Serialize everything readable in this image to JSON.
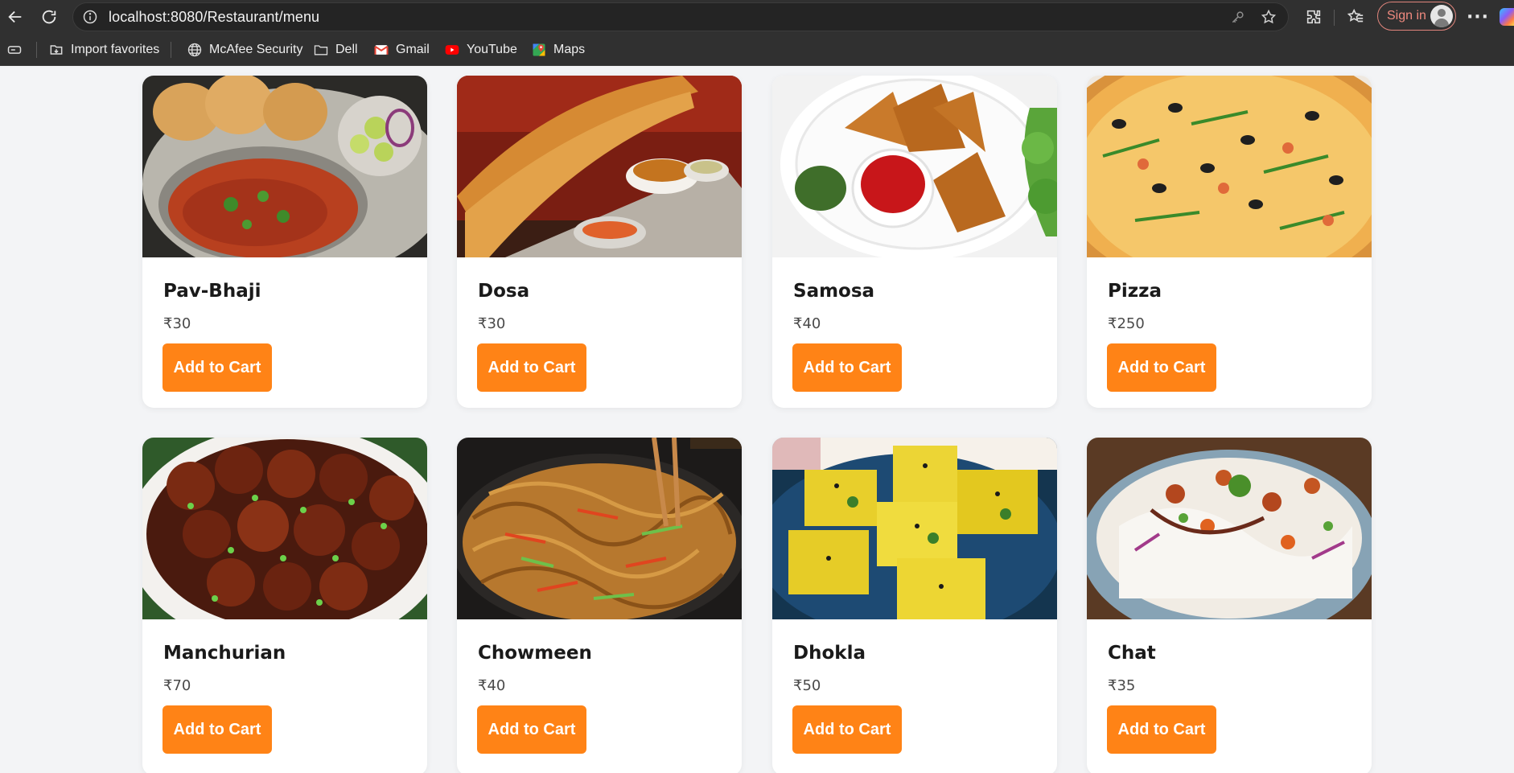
{
  "browser": {
    "url": "localhost:8080/Restaurant/menu",
    "sign_in_label": "Sign in",
    "bookmarks": [
      {
        "label": "Import favorites",
        "icon": "import-icon"
      },
      {
        "label": "McAfee Security",
        "icon": "globe-icon"
      },
      {
        "label": "Dell",
        "icon": "folder-icon"
      },
      {
        "label": "Gmail",
        "icon": "gmail-icon"
      },
      {
        "label": "YouTube",
        "icon": "youtube-icon"
      },
      {
        "label": "Maps",
        "icon": "maps-icon"
      }
    ]
  },
  "menu": {
    "button_label": "Add to Cart",
    "accent_color": "#ff8316",
    "items": [
      {
        "name": "Pav-Bhaji",
        "price": "₹30"
      },
      {
        "name": "Dosa",
        "price": "₹30"
      },
      {
        "name": "Samosa",
        "price": "₹40"
      },
      {
        "name": "Pizza",
        "price": "₹250"
      },
      {
        "name": "Manchurian",
        "price": "₹70"
      },
      {
        "name": "Chowmeen",
        "price": "₹40"
      },
      {
        "name": "Dhokla",
        "price": "₹50"
      },
      {
        "name": "Chat",
        "price": "₹35"
      }
    ]
  }
}
